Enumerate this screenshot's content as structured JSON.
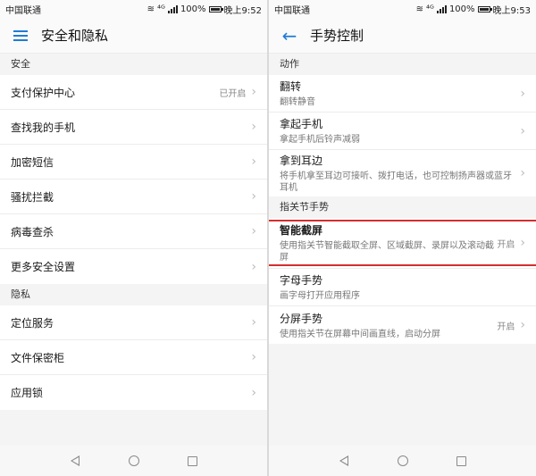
{
  "left": {
    "status": {
      "carrier": "中国联通",
      "network": "⁴ᴳ",
      "battery": "100%",
      "time": "晚上9:52",
      "battery_level": 1.0
    },
    "title": "安全和隐私",
    "sections": [
      {
        "header": "安全",
        "items": [
          {
            "label": "支付保护中心",
            "value": "已开启"
          },
          {
            "label": "查找我的手机"
          },
          {
            "label": "加密短信"
          },
          {
            "label": "骚扰拦截"
          },
          {
            "label": "病毒查杀"
          },
          {
            "label": "更多安全设置"
          }
        ]
      },
      {
        "header": "隐私",
        "items": [
          {
            "label": "定位服务"
          },
          {
            "label": "文件保密柜"
          },
          {
            "label": "应用锁"
          }
        ]
      }
    ]
  },
  "right": {
    "status": {
      "carrier": "中国联通",
      "network": "⁴ᴳ",
      "battery": "100%",
      "time": "晚上9:53",
      "battery_level": 1.0
    },
    "title": "手势控制",
    "sections": [
      {
        "header": "动作",
        "items": [
          {
            "label": "翻转",
            "sub": "翻转静音"
          },
          {
            "label": "拿起手机",
            "sub": "拿起手机后铃声减弱"
          },
          {
            "label": "拿到耳边",
            "sub": "将手机拿至耳边可接听、拨打电话，也可控制扬声器或蓝牙耳机"
          }
        ]
      },
      {
        "header": "指关节手势",
        "items": [
          {
            "label": "智能截屏",
            "sub": "使用指关节智能截取全屏、区域截屏、录屏以及滚动截屏",
            "value": "开启"
          },
          {
            "label": "字母手势",
            "sub": "画字母打开应用程序"
          },
          {
            "label": "分屏手势",
            "sub": "使用指关节在屏幕中间画直线，启动分屏",
            "value": "开启"
          }
        ]
      }
    ]
  },
  "colors": {
    "accent": "#1e7bd6",
    "highlight": "#d32f2f",
    "background": "#f4f4f4"
  },
  "icons": {
    "menu": "hamburger-icon",
    "back": "back-arrow-icon",
    "chevron": "chevron-right-icon"
  }
}
